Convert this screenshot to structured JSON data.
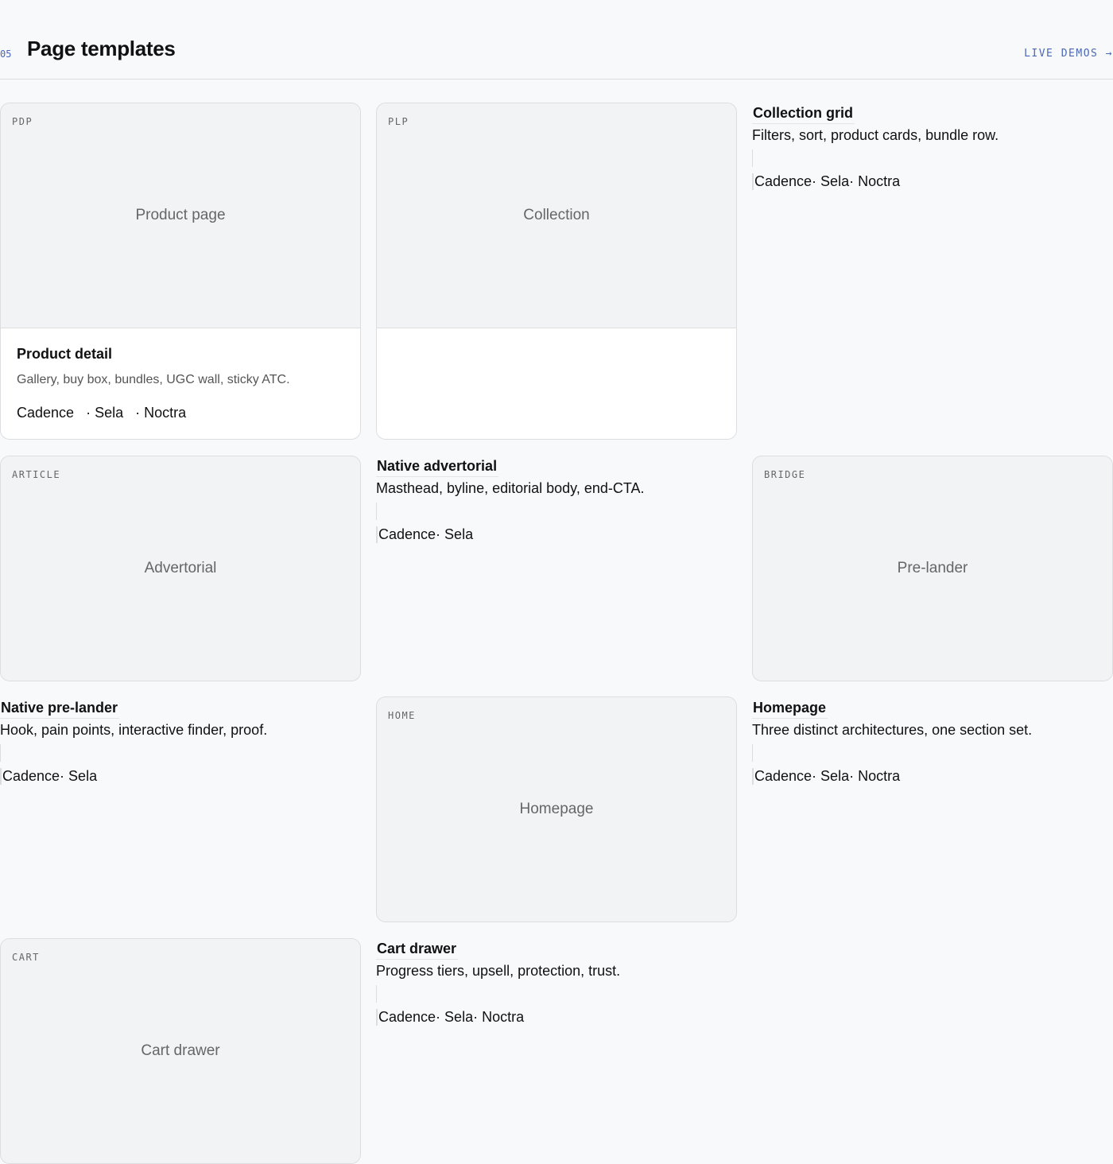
{
  "section": {
    "number": "05",
    "title": "Page templates",
    "link": "LIVE DEMOS →"
  },
  "cards": {
    "pdp": {
      "tag": "PDP",
      "label": "Product page",
      "title": "Product detail",
      "desc": "Gallery, buy box, bundles, UGC wall, sticky ATC.",
      "brands": [
        "Cadence",
        "· Sela",
        "· Noctra"
      ]
    },
    "plp": {
      "tag": "PLP",
      "label": "Collection"
    },
    "article": {
      "tag": "ARTICLE",
      "label": "Advertorial"
    },
    "bridge": {
      "tag": "BRIDGE",
      "label": "Pre-lander"
    },
    "home": {
      "tag": "HOME",
      "label": "Homepage"
    },
    "cart": {
      "tag": "CART",
      "label": "Cart drawer"
    }
  },
  "info": {
    "collection": {
      "title": "Collection grid",
      "desc": "Filters, sort, product cards, bundle row.",
      "brands": "Cadence· Sela· Noctra"
    },
    "advertorial": {
      "title": "Native advertorial",
      "desc": "Masthead, byline, editorial body, end-CTA.",
      "brands": "Cadence· Sela"
    },
    "prelander": {
      "title": "Native pre-lander",
      "desc": "Hook, pain points, interactive finder, proof.",
      "brands": "Cadence· Sela"
    },
    "homepage": {
      "title": "Homepage",
      "desc": "Three distinct architectures, one section set.",
      "brands": "Cadence· Sela· Noctra"
    },
    "cart": {
      "title": "Cart drawer",
      "desc": "Progress tiers, upsell, protection, trust.",
      "brands": "Cadence· Sela· Noctra"
    }
  }
}
